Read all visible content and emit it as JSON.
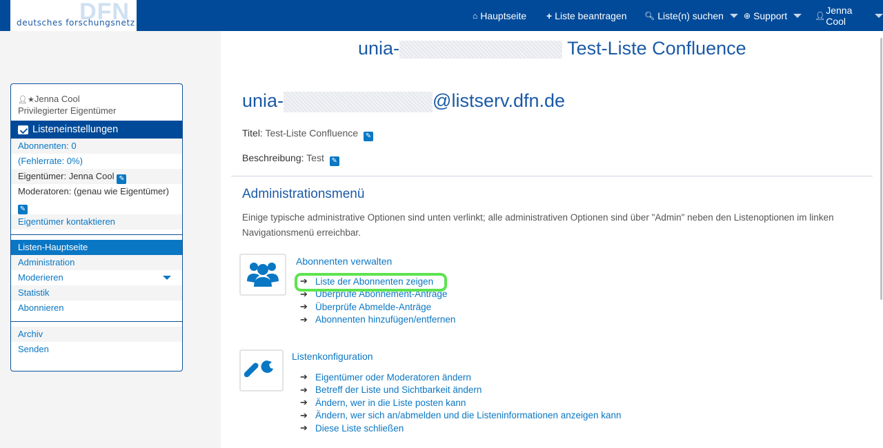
{
  "logo": {
    "mark": "DFN",
    "text": "deutsches forschungsnetz"
  },
  "nav": {
    "home": "Hauptseite",
    "request": "Liste beantragen",
    "search": "Liste(n) suchen",
    "support": "Support",
    "user": "Jenna Cool"
  },
  "sidebar": {
    "user_name": "Jenna Cool",
    "user_role": "Privilegierter Eigentümer",
    "section_title": "Listeneinstellungen",
    "subscribers": "Abonnenten: 0",
    "error_rate": "(Fehlerrate: 0%)",
    "owner": "Eigentümer: Jenna Cool",
    "moderators": "Moderatoren: (genau wie Eigentümer)",
    "contact_owner": "Eigentümer kontaktieren",
    "menu": [
      "Listen-Hauptseite",
      "Administration",
      "Moderieren",
      "Statistik",
      "Abonnieren"
    ],
    "menu2": [
      "Archiv",
      "Senden"
    ]
  },
  "main": {
    "title_prefix": "unia-",
    "title_suffix": "Test-Liste Confluence",
    "address_prefix": "unia-",
    "address_suffix": "@listserv.dfn.de",
    "title_label": "Titel:",
    "title_value": "Test-Liste Confluence",
    "desc_label": "Beschreibung:",
    "desc_value": "Test",
    "admin_heading": "Administrationsmenü",
    "admin_text": "Einige typische administrative Optionen sind unten verlinkt; alle administrativen Optionen sind über \"Admin\" neben den Listenoptionen im linken Navigationsmenü erreichbar.",
    "group1": {
      "title": "Abonnenten verwalten",
      "links": [
        "Liste der Abonnenten zeigen",
        "Überprüfe Abonnement-Anträge",
        "Überprüfe Abmelde-Anträge",
        "Abonnenten hinzufügen/entfernen"
      ]
    },
    "group2": {
      "title": "Listenkonfiguration",
      "links": [
        "Eigentümer oder Moderatoren ändern",
        "Betreff der Liste und Sichtbarkeit ändern",
        "Ändern, wer in die Liste posten kann",
        "Ändern, wer sich an/abmelden und die Listeninformationen anzeigen kann",
        "Diese Liste schließen"
      ]
    }
  },
  "colors": {
    "navbar": "#004a99",
    "link": "#0a77c4",
    "highlight": "#5ee34f"
  }
}
